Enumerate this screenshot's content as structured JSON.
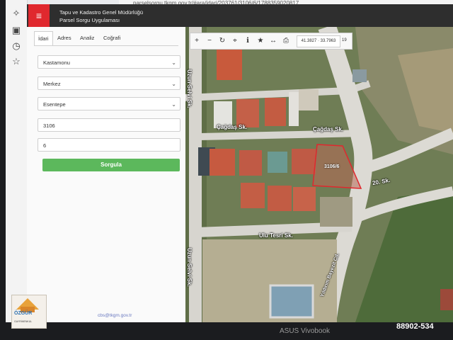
{
  "browser": {
    "url": "parselsorgu.tkgm.gov.tr/#ara/idari/203761/3106/6/1788359020817"
  },
  "header": {
    "title_line1": "Tapu ve Kadastro Genel Müdürlüğü",
    "title_line2": "Parsel Sorgu Uygulaması",
    "menu_icon": "hamburger-icon",
    "accent_color": "#e0282e"
  },
  "tabs": [
    {
      "label": "İdari"
    },
    {
      "label": "Adres"
    },
    {
      "label": "Analiz"
    },
    {
      "label": "Coğrafi"
    }
  ],
  "form": {
    "il": "Kastamonu",
    "ilce": "Merkez",
    "mahalle": "Esentepe",
    "ada": "3106",
    "parsel": "6",
    "submit_label": "Sorgula",
    "submit_color": "#5cb85c"
  },
  "footer": {
    "link": "cbs@tkgm.gov.tr"
  },
  "map": {
    "toolbar": {
      "coords": "41.3827 · 33.7963",
      "zoom": "19"
    },
    "streets": {
      "uzun_selvi_top": "Uzun Selvi Sk.",
      "cagdas_left": "Çağdaş Sk.",
      "cagdas_right": "Çağdaş Sk.",
      "street_20": "20. Sk.",
      "ulu_tesri": "Ulu Tesri Sk.",
      "uzun_selvi_bottom": "Uzun Selvi Sk.",
      "yildirim_bayezit": "Yıldırım Bayezit Cd."
    },
    "parcel_label": "3106/6",
    "parcel_outline_color": "#e0282e"
  },
  "device": {
    "brand": "ASUS Vivobook"
  },
  "watermark": {
    "listing_number": "88902-534",
    "logo_text": "ÖZGÜR",
    "logo_sub": "GAYRİMENKUL"
  }
}
